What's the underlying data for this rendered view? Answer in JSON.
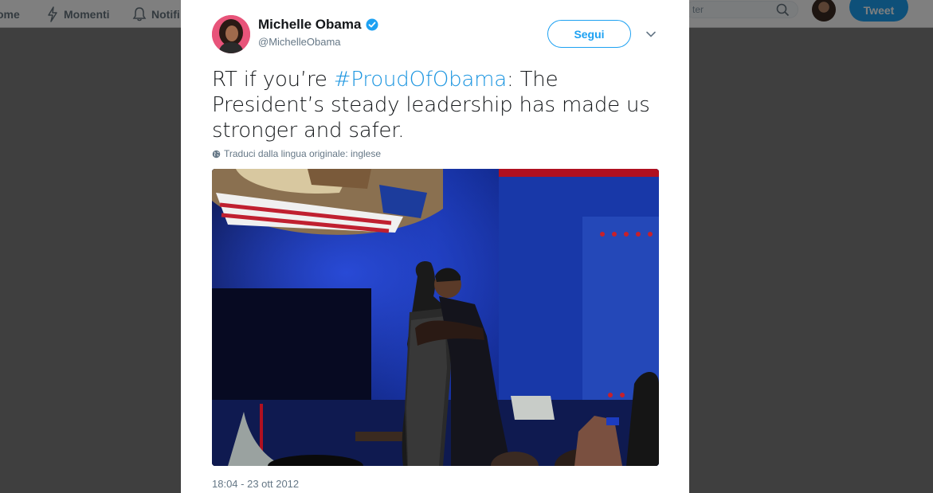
{
  "nav": {
    "home_label": "ome",
    "moments_label": "Momenti",
    "notifications_label": "Notifi",
    "search_placeholder": "ter",
    "tweet_button": "Tweet"
  },
  "tweet": {
    "author_name": "Michelle Obama",
    "author_handle": "@MichelleObama",
    "follow_label": "Segui",
    "text_before": "RT if you’re ",
    "hashtag": "#ProudOfObama",
    "text_after": ": The President’s steady leadership has made us stronger and safer.",
    "translate_label": "Traduci dalla lingua originale: inglese",
    "timestamp": "18:04 - 23 ott 2012"
  },
  "icons": {
    "verified": "verified-badge-icon",
    "caret": "chevron-down-icon",
    "globe": "globe-icon",
    "search": "search-icon",
    "moments": "lightning-icon",
    "notifications": "bell-icon"
  },
  "colors": {
    "accent": "#1da1f2",
    "hashtag": "#1b95e0",
    "overlay": "#7f7f7f"
  }
}
